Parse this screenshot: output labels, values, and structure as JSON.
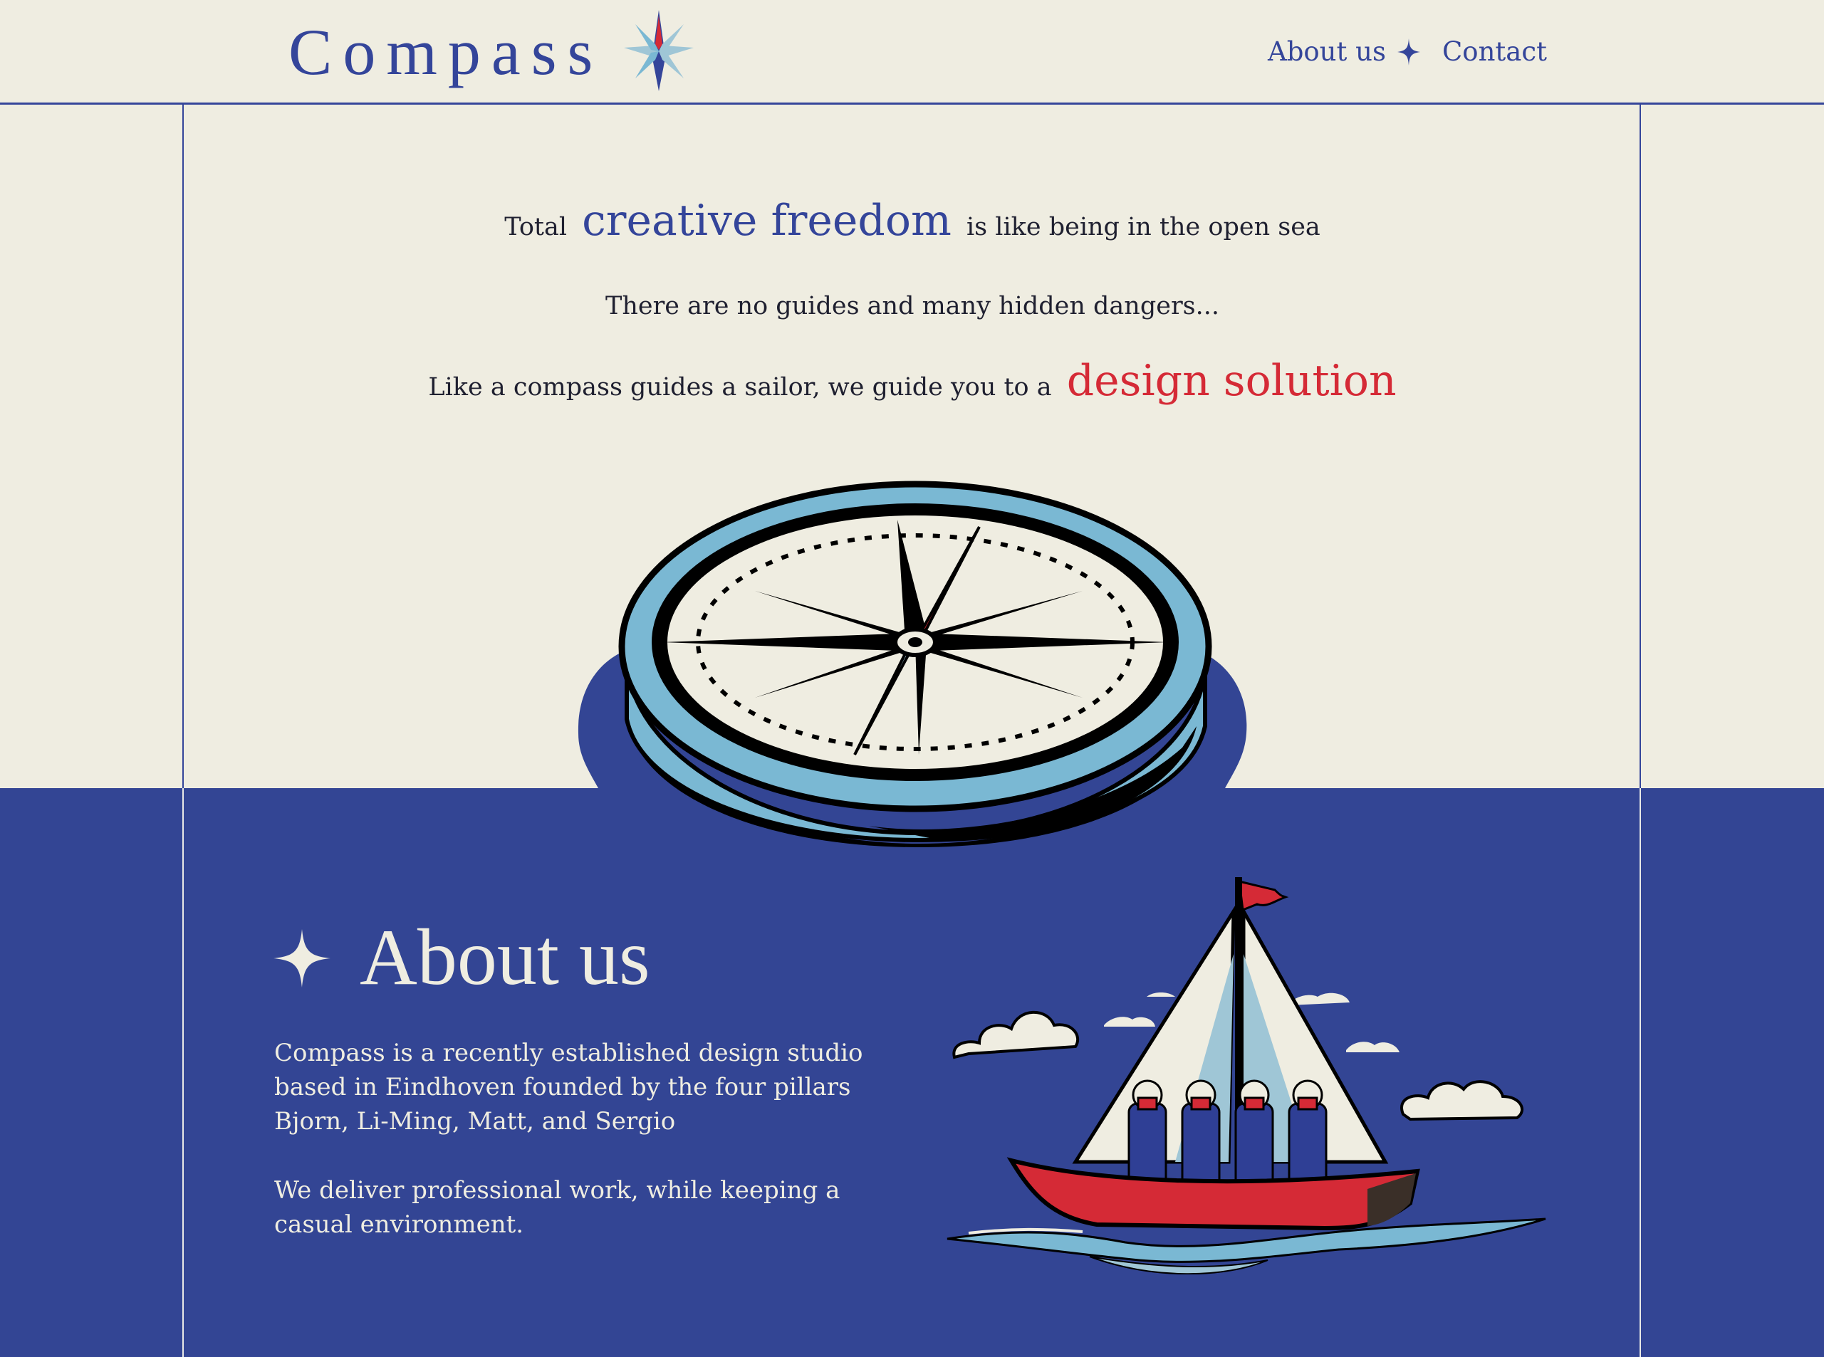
{
  "header": {
    "brand": "Compass",
    "nav": {
      "about": "About us",
      "contact": "Contact"
    }
  },
  "hero": {
    "line1_before": "Total",
    "line1_highlight": "creative freedom",
    "line1_after": "is like being in the open sea",
    "line2": "There are no guides and many hidden dangers...",
    "line3_before": "Like a compass guides a sailor, we guide you to a",
    "line3_highlight": "design solution"
  },
  "about": {
    "title": "About us",
    "paragraph1": "Compass is a recently established design studio based in Eindhoven founded by the four pillars Bjorn, Li-Ming, Matt, and Sergio",
    "paragraph2": "We deliver professional work, while keeping a casual environment."
  },
  "colors": {
    "background": "#efede1",
    "brand_blue": "#34459a",
    "band_blue": "#334594",
    "accent_red": "#d52a36",
    "light_blue": "#7ab8d3"
  },
  "icons": {
    "logo": "compass-star-icon",
    "nav_separator": "four-point-star-icon",
    "about_marker": "four-point-star-icon"
  }
}
